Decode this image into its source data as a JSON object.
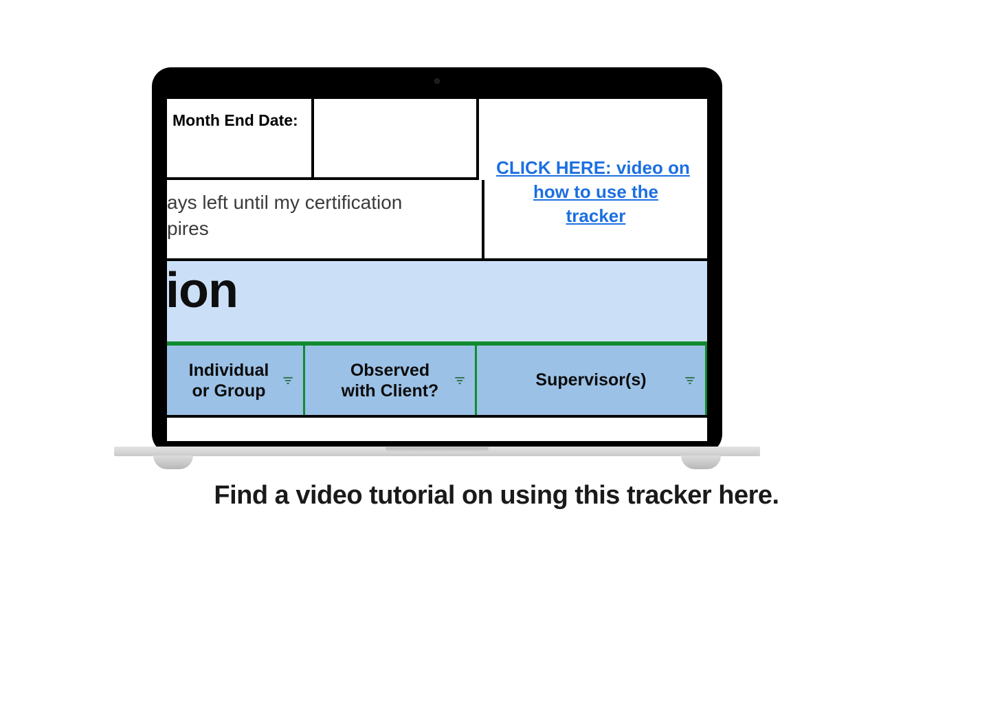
{
  "top": {
    "month_end_label": "Month End Date:",
    "video_link_line1": "CLICK HERE: video on",
    "video_link_line2": "how to use the",
    "video_link_line3": "tracker"
  },
  "cert_text_line1": "ays left until my certification",
  "cert_text_line2": "pires",
  "section_fragment": "ion",
  "headers": {
    "col1_line1": "Individual",
    "col1_line2": "or Group",
    "col2_line1": "Observed",
    "col2_line2": "with Client?",
    "col3": "Supervisor(s)"
  },
  "caption": "Find a video tutorial on using this tracker here."
}
